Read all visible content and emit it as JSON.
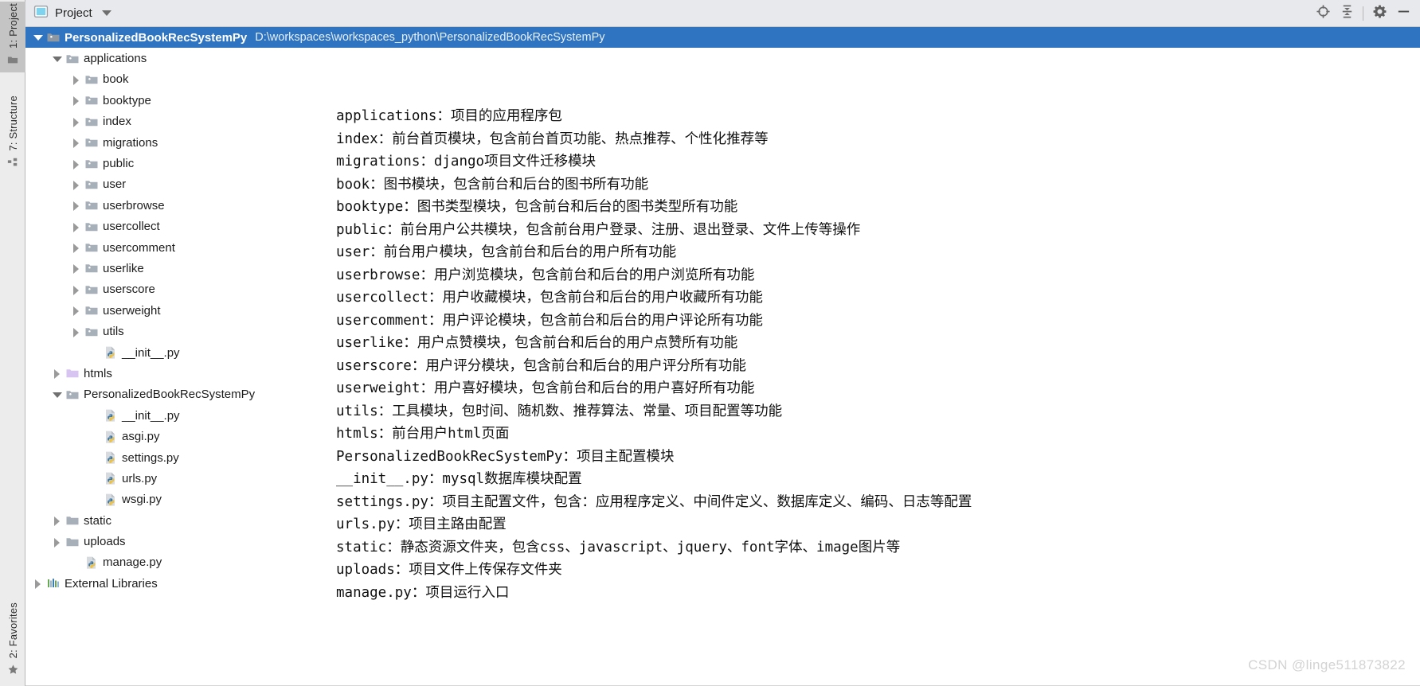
{
  "toolwindow": {
    "tabs": [
      {
        "label": "1: Project",
        "icon": "project-folder-icon",
        "selected": true
      },
      {
        "label": "7: Structure",
        "icon": "structure-icon",
        "selected": false
      }
    ],
    "bottom_tabs": [
      {
        "label": "2: Favorites",
        "icon": "star-icon",
        "selected": false
      }
    ]
  },
  "header": {
    "title": "Project",
    "dropdown_icon": "chevron-down-icon",
    "buttons": [
      {
        "name": "scroll-from-source-button",
        "icon": "target-icon",
        "label": "Select Opened File"
      },
      {
        "name": "collapse-all-button",
        "icon": "collapse-all-icon",
        "label": "Collapse All"
      },
      {
        "name": "settings-button",
        "icon": "gear-icon",
        "label": "Settings"
      },
      {
        "name": "hide-button",
        "icon": "minimize-icon",
        "label": "Hide"
      }
    ]
  },
  "tree": {
    "rows": [
      {
        "label": "PersonalizedBookRecSystemPy",
        "path": "D:\\workspaces\\workspaces_python\\PersonalizedBookRecSystemPy",
        "indent": 0,
        "arrow": "down",
        "icon": "module-folder-icon",
        "selected": true,
        "bold": true
      },
      {
        "label": "applications",
        "indent": 1,
        "arrow": "down",
        "icon": "source-folder-icon",
        "selected": false,
        "bold": false
      },
      {
        "label": "book",
        "indent": 2,
        "arrow": "right",
        "icon": "source-folder-icon",
        "selected": false,
        "bold": false
      },
      {
        "label": "booktype",
        "indent": 2,
        "arrow": "right",
        "icon": "source-folder-icon",
        "selected": false,
        "bold": false
      },
      {
        "label": "index",
        "indent": 2,
        "arrow": "right",
        "icon": "source-folder-icon",
        "selected": false,
        "bold": false
      },
      {
        "label": "migrations",
        "indent": 2,
        "arrow": "right",
        "icon": "source-folder-icon",
        "selected": false,
        "bold": false
      },
      {
        "label": "public",
        "indent": 2,
        "arrow": "right",
        "icon": "source-folder-icon",
        "selected": false,
        "bold": false
      },
      {
        "label": "user",
        "indent": 2,
        "arrow": "right",
        "icon": "source-folder-icon",
        "selected": false,
        "bold": false
      },
      {
        "label": "userbrowse",
        "indent": 2,
        "arrow": "right",
        "icon": "source-folder-icon",
        "selected": false,
        "bold": false
      },
      {
        "label": "usercollect",
        "indent": 2,
        "arrow": "right",
        "icon": "source-folder-icon",
        "selected": false,
        "bold": false
      },
      {
        "label": "usercomment",
        "indent": 2,
        "arrow": "right",
        "icon": "source-folder-icon",
        "selected": false,
        "bold": false
      },
      {
        "label": "userlike",
        "indent": 2,
        "arrow": "right",
        "icon": "source-folder-icon",
        "selected": false,
        "bold": false
      },
      {
        "label": "userscore",
        "indent": 2,
        "arrow": "right",
        "icon": "source-folder-icon",
        "selected": false,
        "bold": false
      },
      {
        "label": "userweight",
        "indent": 2,
        "arrow": "right",
        "icon": "source-folder-icon",
        "selected": false,
        "bold": false
      },
      {
        "label": "utils",
        "indent": 2,
        "arrow": "right",
        "icon": "source-folder-icon",
        "selected": false,
        "bold": false
      },
      {
        "label": "__init__.py",
        "indent": 3,
        "arrow": "none",
        "icon": "python-file-icon",
        "selected": false,
        "bold": false
      },
      {
        "label": "htmls",
        "indent": 1,
        "arrow": "right",
        "icon": "template-folder-icon",
        "selected": false,
        "bold": false
      },
      {
        "label": "PersonalizedBookRecSystemPy",
        "indent": 1,
        "arrow": "down",
        "icon": "source-folder-icon",
        "selected": false,
        "bold": false
      },
      {
        "label": "__init__.py",
        "indent": 3,
        "arrow": "none",
        "icon": "python-file-icon",
        "selected": false,
        "bold": false
      },
      {
        "label": "asgi.py",
        "indent": 3,
        "arrow": "none",
        "icon": "python-file-icon",
        "selected": false,
        "bold": false
      },
      {
        "label": "settings.py",
        "indent": 3,
        "arrow": "none",
        "icon": "python-file-icon",
        "selected": false,
        "bold": false
      },
      {
        "label": "urls.py",
        "indent": 3,
        "arrow": "none",
        "icon": "python-file-icon",
        "selected": false,
        "bold": false
      },
      {
        "label": "wsgi.py",
        "indent": 3,
        "arrow": "none",
        "icon": "python-file-icon",
        "selected": false,
        "bold": false
      },
      {
        "label": "static",
        "indent": 1,
        "arrow": "right",
        "icon": "plain-folder-icon",
        "selected": false,
        "bold": false
      },
      {
        "label": "uploads",
        "indent": 1,
        "arrow": "right",
        "icon": "plain-folder-icon",
        "selected": false,
        "bold": false
      },
      {
        "label": "manage.py",
        "indent": 2,
        "arrow": "none",
        "icon": "python-file-icon",
        "selected": false,
        "bold": false
      },
      {
        "label": "External Libraries",
        "indent": 0,
        "arrow": "right",
        "icon": "libraries-icon",
        "selected": false,
        "bold": false
      }
    ]
  },
  "description": {
    "lines": [
      "applications：项目的应用程序包",
      "index：前台首页模块，包含前台首页功能、热点推荐、个性化推荐等",
      "migrations：django项目文件迁移模块",
      "book：图书模块，包含前台和后台的图书所有功能",
      "booktype：图书类型模块，包含前台和后台的图书类型所有功能",
      "public：前台用户公共模块，包含前台用户登录、注册、退出登录、文件上传等操作",
      "user：前台用户模块，包含前台和后台的用户所有功能",
      "userbrowse：用户浏览模块，包含前台和后台的用户浏览所有功能",
      "usercollect：用户收藏模块，包含前台和后台的用户收藏所有功能",
      "usercomment：用户评论模块，包含前台和后台的用户评论所有功能",
      "userlike：用户点赞模块，包含前台和后台的用户点赞所有功能",
      "userscore：用户评分模块，包含前台和后台的用户评分所有功能",
      "userweight：用户喜好模块，包含前台和后台的用户喜好所有功能",
      "utils：工具模块，包时间、随机数、推荐算法、常量、项目配置等功能",
      "htmls：前台用户html页面",
      "PersonalizedBookRecSystemPy：项目主配置模块",
      "__init__.py：mysql数据库模块配置",
      "settings.py：项目主配置文件，包含：应用程序定义、中间件定义、数据库定义、编码、日志等配置",
      "urls.py：项目主路由配置",
      "static：静态资源文件夹，包含css、javascript、jquery、font字体、image图片等",
      "uploads：项目文件上传保存文件夹",
      "manage.py：项目运行入口"
    ]
  },
  "watermark": {
    "text": "CSDN @linge511873822"
  },
  "colors": {
    "selection_blue": "#2f74c0",
    "header_bg": "#e8e9ed",
    "toolstrip_bg": "#ececec",
    "folder_gray": "#a3acb5",
    "template_purple": "#d8c6f0",
    "text": "#1c1c1c"
  }
}
